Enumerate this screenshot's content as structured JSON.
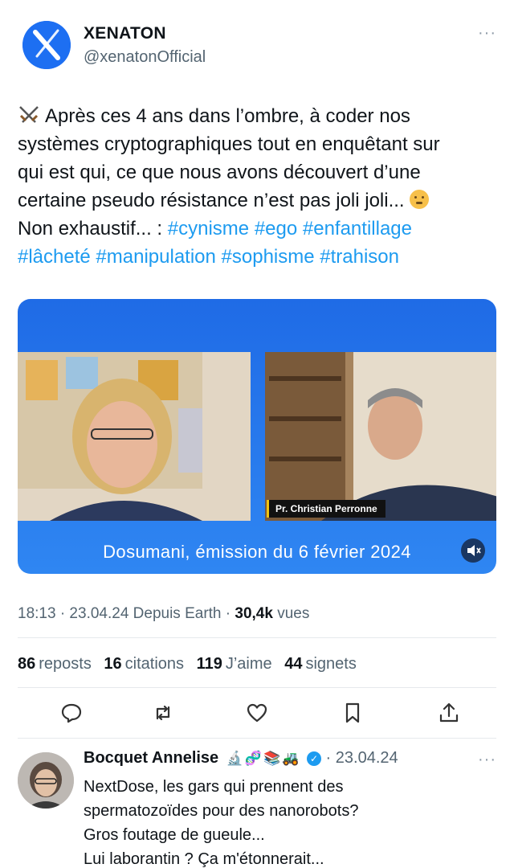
{
  "account": {
    "name": "XENATON",
    "handle": "@xenatonOfficial",
    "more": "···"
  },
  "tweet": {
    "line1": "Après ces 4 ans dans l’ombre, à coder nos",
    "line2": "systèmes cryptographiques tout en enquêtant sur",
    "line3": "qui est qui, ce que nous avons découvert d’une",
    "line4": "certaine pseudo résistance n’est pas joli joli...",
    "line5_prefix": "Non exhaustif... : ",
    "hashtags_line5": [
      "#cynisme",
      "#ego",
      "#enfantillage"
    ],
    "hashtags_line6": [
      "#lâcheté",
      "#manipulation",
      "#sophisme",
      "#trahison"
    ]
  },
  "video": {
    "speaker_tag": "Pr. Christian Perronne",
    "caption": "Dosumani, émission du 6 février 2024",
    "volume_icon": "speaker-muted-icon"
  },
  "meta": {
    "time_date": "18:13 · 23.04.24 Depuis Earth · ",
    "views_count": "30,4k",
    "views_label": " vues"
  },
  "stats": {
    "reposts_count": "86",
    "reposts_label": "reposts",
    "quotes_count": "16",
    "quotes_label": "citations",
    "likes_count": "119",
    "likes_label": "J’aime",
    "bookmarks_count": "44",
    "bookmarks_label": "signets"
  },
  "actions": [
    "reply-icon",
    "repost-icon",
    "like-icon",
    "bookmark-icon",
    "share-icon"
  ],
  "reply": {
    "name": "Bocquet Annelise",
    "emojis": "🔬🧬📚🚜",
    "verified": "✓",
    "date": " · 23.04.24",
    "more": "···",
    "lines": [
      "NextDose, les gars qui prennent des",
      "spermatozoïdes pour des nanorobots?",
      "Gros foutage de gueule...",
      "Lui laborantin ? Ça m'étonnerait..."
    ]
  },
  "colors": {
    "accent": "#1d9bf0",
    "video_blue": "#1f6be6",
    "text": "#0f1419",
    "muted": "#536471"
  }
}
